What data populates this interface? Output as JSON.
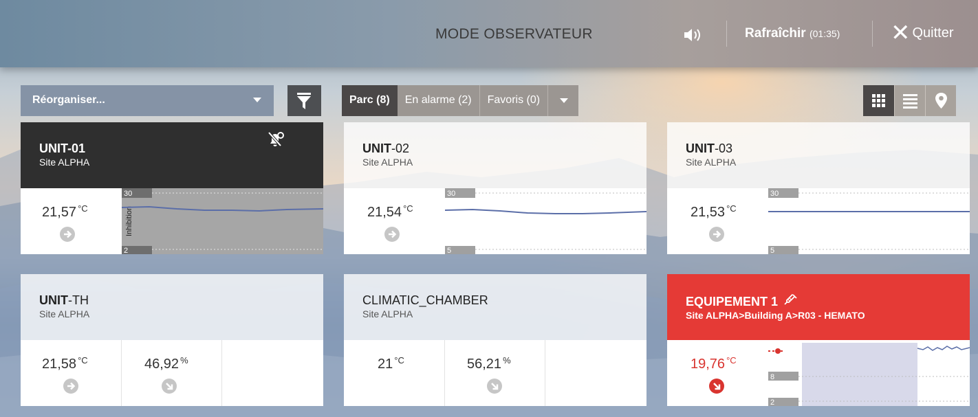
{
  "header": {
    "title": "MODE OBSERVATEUR",
    "refresh_label": "Rafraîchir",
    "refresh_timer": "(01:35)",
    "quit_label": "Quitter"
  },
  "toolbar": {
    "reorganize_label": "Réorganiser...",
    "tabs": [
      {
        "label": "Parc (8)",
        "active": true
      },
      {
        "label": "En alarme (2)",
        "active": false
      },
      {
        "label": "Favoris (0)",
        "active": false
      }
    ],
    "views": [
      "grid-view",
      "list-view",
      "map-view"
    ],
    "active_view": "grid-view"
  },
  "cards": [
    {
      "name_bold": "UNIT-01",
      "name_rest": "",
      "site": "Site ALPHA",
      "style": "dark",
      "value": "21,57",
      "unit": "°C",
      "trend": "right",
      "chart_labels": {
        "high": "30",
        "low": "2"
      },
      "inhibition_label": "Inhibition"
    },
    {
      "name_bold": "UNIT",
      "name_rest": "-02",
      "site": "Site ALPHA",
      "style": "light",
      "value": "21,54",
      "unit": "°C",
      "trend": "right",
      "chart_labels": {
        "high": "30",
        "low": "5"
      }
    },
    {
      "name_bold": "UNIT",
      "name_rest": "-03",
      "site": "Site ALPHA",
      "style": "light",
      "value": "21,53",
      "unit": "°C",
      "trend": "right",
      "chart_labels": {
        "high": "30",
        "low": "5"
      }
    },
    {
      "name_bold": "UNIT",
      "name_rest": "-TH",
      "site": "Site ALPHA",
      "style": "light",
      "value": "21,58",
      "unit": "°C",
      "trend": "right",
      "value2": "46,92",
      "unit2": "%",
      "trend2": "down-right"
    },
    {
      "name_bold": "",
      "name_rest": "CLIMATIC_CHAMBER",
      "site": "Site ALPHA",
      "style": "light",
      "value": "21",
      "unit": "°C",
      "trend": "none",
      "value2": "56,21",
      "unit2": "%",
      "trend2": "down-right"
    },
    {
      "name_bold": "",
      "name_rest": "EQUIPEMENT 1",
      "site": "Site ALPHA>Building A>R03 - HEMATO",
      "style": "red",
      "value": "19,76",
      "unit": "°C",
      "trend": "down-right-alarm",
      "chart_labels": {
        "high": "8",
        "low": "2"
      }
    }
  ],
  "colors": {
    "topbar": "#8a9bab",
    "tab_active": "#4a4747",
    "alarm": "#e53a36",
    "series": "#5b6ea8",
    "reorganize": "#8593a6"
  },
  "icons": {
    "sound": "speaker-icon",
    "quit": "close-icon",
    "filter": "filter-icon",
    "alarm_muted": "bell-muted-icon",
    "probe": "syringe-icon"
  }
}
